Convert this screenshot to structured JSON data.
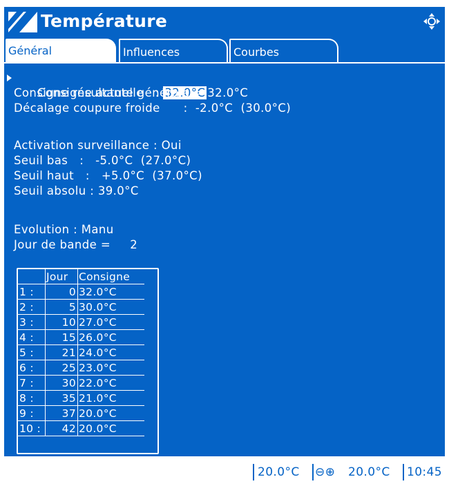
{
  "header": {
    "title": "Température"
  },
  "tabs": [
    {
      "label": "Général"
    },
    {
      "label": "Influences"
    },
    {
      "label": "Courbes"
    }
  ],
  "settings": {
    "consigne_actuelle_label": "Consigne actuelle",
    "consigne_actuelle_sep": "   :",
    "consigne_actuelle_value": "32.0°C",
    "consigne_resultante": "Consigne résultante générale = 32.0°C",
    "decalage": "Décalage coupure froide      :  -2.0°C  (30.0°C)",
    "activation": "Activation surveillance : Oui",
    "seuil_bas": "Seuil bas   :   -5.0°C  (27.0°C)",
    "seuil_haut": "Seuil haut   :   +5.0°C  (37.0°C)",
    "seuil_absolu": "Seuil absolu : 39.0°C",
    "evolution": "Evolution : Manu",
    "jour_de_bande": "Jour de bande =     2"
  },
  "table": {
    "headers": [
      "",
      "Jour",
      "Consigne"
    ],
    "rows": [
      [
        "1 :",
        "0",
        "32.0°C"
      ],
      [
        "2 :",
        "5",
        "30.0°C"
      ],
      [
        "3 :",
        "10",
        "27.0°C"
      ],
      [
        "4 :",
        "15",
        "26.0°C"
      ],
      [
        "5 :",
        "21",
        "24.0°C"
      ],
      [
        "6 :",
        "25",
        "23.0°C"
      ],
      [
        "7 :",
        "30",
        "22.0°C"
      ],
      [
        "8 :",
        "35",
        "21.0°C"
      ],
      [
        "9 :",
        "37",
        "20.0°C"
      ],
      [
        "10 :",
        "42",
        "20.0°C"
      ]
    ]
  },
  "status": {
    "temp_left": "20.0°C",
    "minus_plus": "⊖⊕",
    "temp_right": "20.0°C",
    "time": "10:45"
  },
  "colors": {
    "accent": "#0563c6",
    "text": "#ffffff",
    "background": "#ffffff"
  }
}
